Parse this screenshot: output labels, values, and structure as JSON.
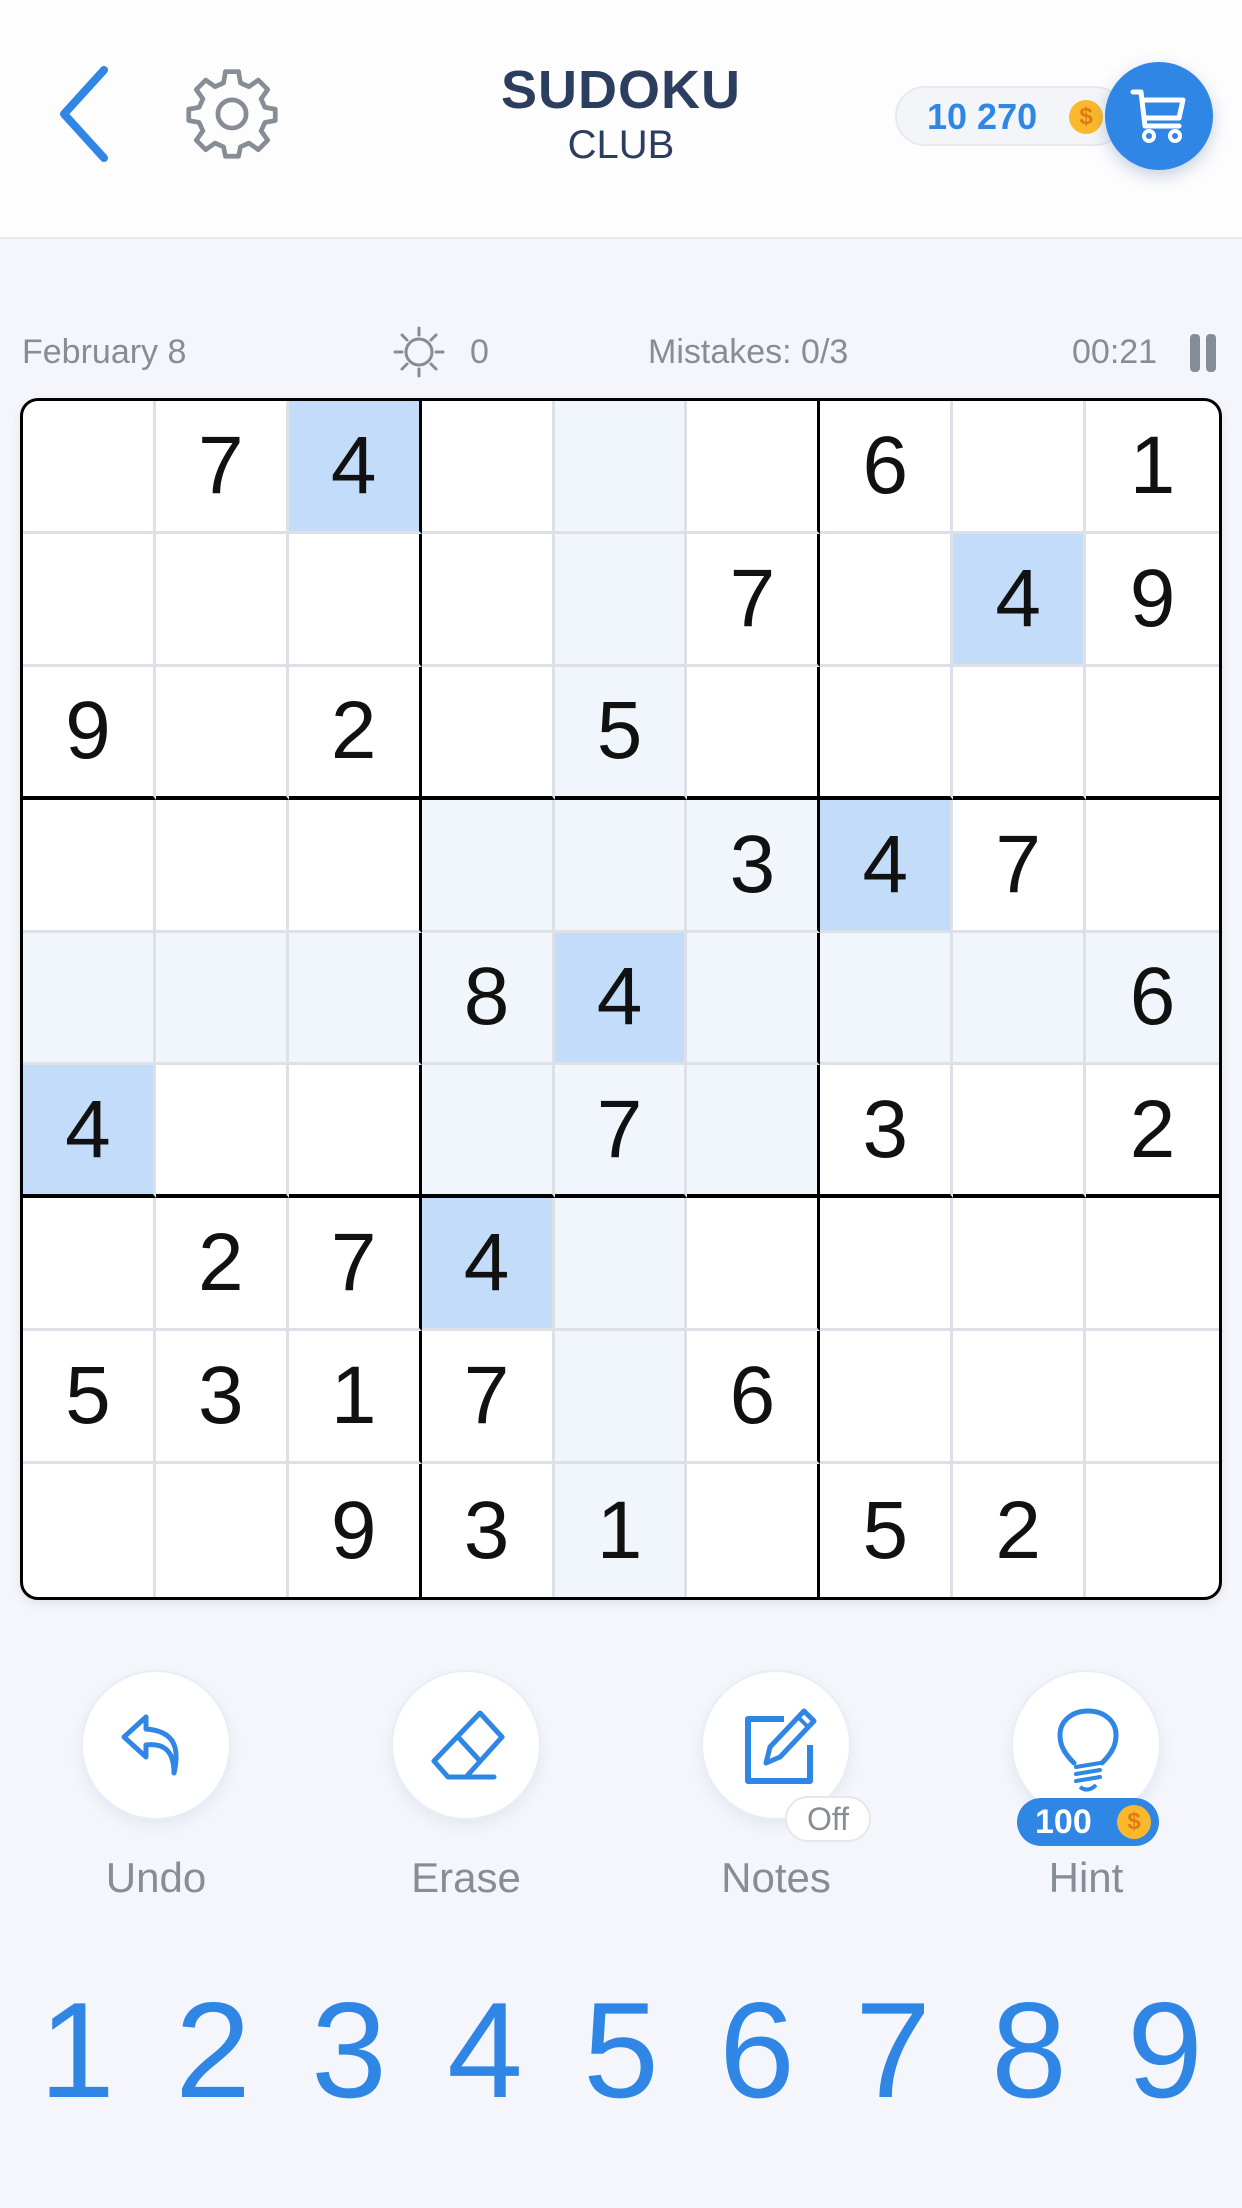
{
  "header": {
    "back_icon": "chevron-left-icon",
    "settings_icon": "gear-icon",
    "title_line1": "SUDOKU",
    "title_line2": "CLUB",
    "coin_balance": "10 270",
    "coin_symbol": "$",
    "cart_icon": "shopping-cart-icon"
  },
  "status": {
    "date": "February 8",
    "brightness_icon": "sun-icon",
    "brightness_value": "0",
    "mistakes": "Mistakes: 0/3",
    "timer": "00:21",
    "pause_icon": "pause-icon"
  },
  "board": {
    "selected": {
      "row": 5,
      "col": 5
    },
    "highlighted_digit": "4",
    "colors": {
      "selected_same": "#c2dcfa",
      "related": "#f1f6fd",
      "accent": "#2f86e5"
    },
    "rows": [
      [
        "",
        "7",
        "4",
        "",
        "",
        "",
        "6",
        "",
        "1"
      ],
      [
        "",
        "",
        "",
        "",
        "",
        "7",
        "",
        "4",
        "9"
      ],
      [
        "9",
        "",
        "2",
        "",
        "5",
        "",
        "",
        "",
        ""
      ],
      [
        "",
        "",
        "",
        "",
        "",
        "3",
        "4",
        "7",
        ""
      ],
      [
        "",
        "",
        "",
        "8",
        "4",
        "",
        "",
        "",
        "6"
      ],
      [
        "4",
        "",
        "",
        "",
        "7",
        "",
        "3",
        "",
        "2"
      ],
      [
        "",
        "2",
        "7",
        "4",
        "",
        "",
        "",
        "",
        ""
      ],
      [
        "5",
        "3",
        "1",
        "7",
        "",
        "6",
        "",
        "",
        ""
      ],
      [
        "",
        "",
        "9",
        "3",
        "1",
        "",
        "5",
        "2",
        ""
      ]
    ]
  },
  "actions": [
    {
      "id": "undo",
      "label": "Undo",
      "icon": "undo-arrow-icon"
    },
    {
      "id": "erase",
      "label": "Erase",
      "icon": "eraser-icon"
    },
    {
      "id": "notes",
      "label": "Notes",
      "icon": "pencil-notes-icon",
      "badge": "Off"
    },
    {
      "id": "hint",
      "label": "Hint",
      "icon": "lightbulb-icon",
      "badge": "100",
      "badge_coin": "$"
    }
  ],
  "numpad": [
    "1",
    "2",
    "3",
    "4",
    "5",
    "6",
    "7",
    "8",
    "9"
  ]
}
